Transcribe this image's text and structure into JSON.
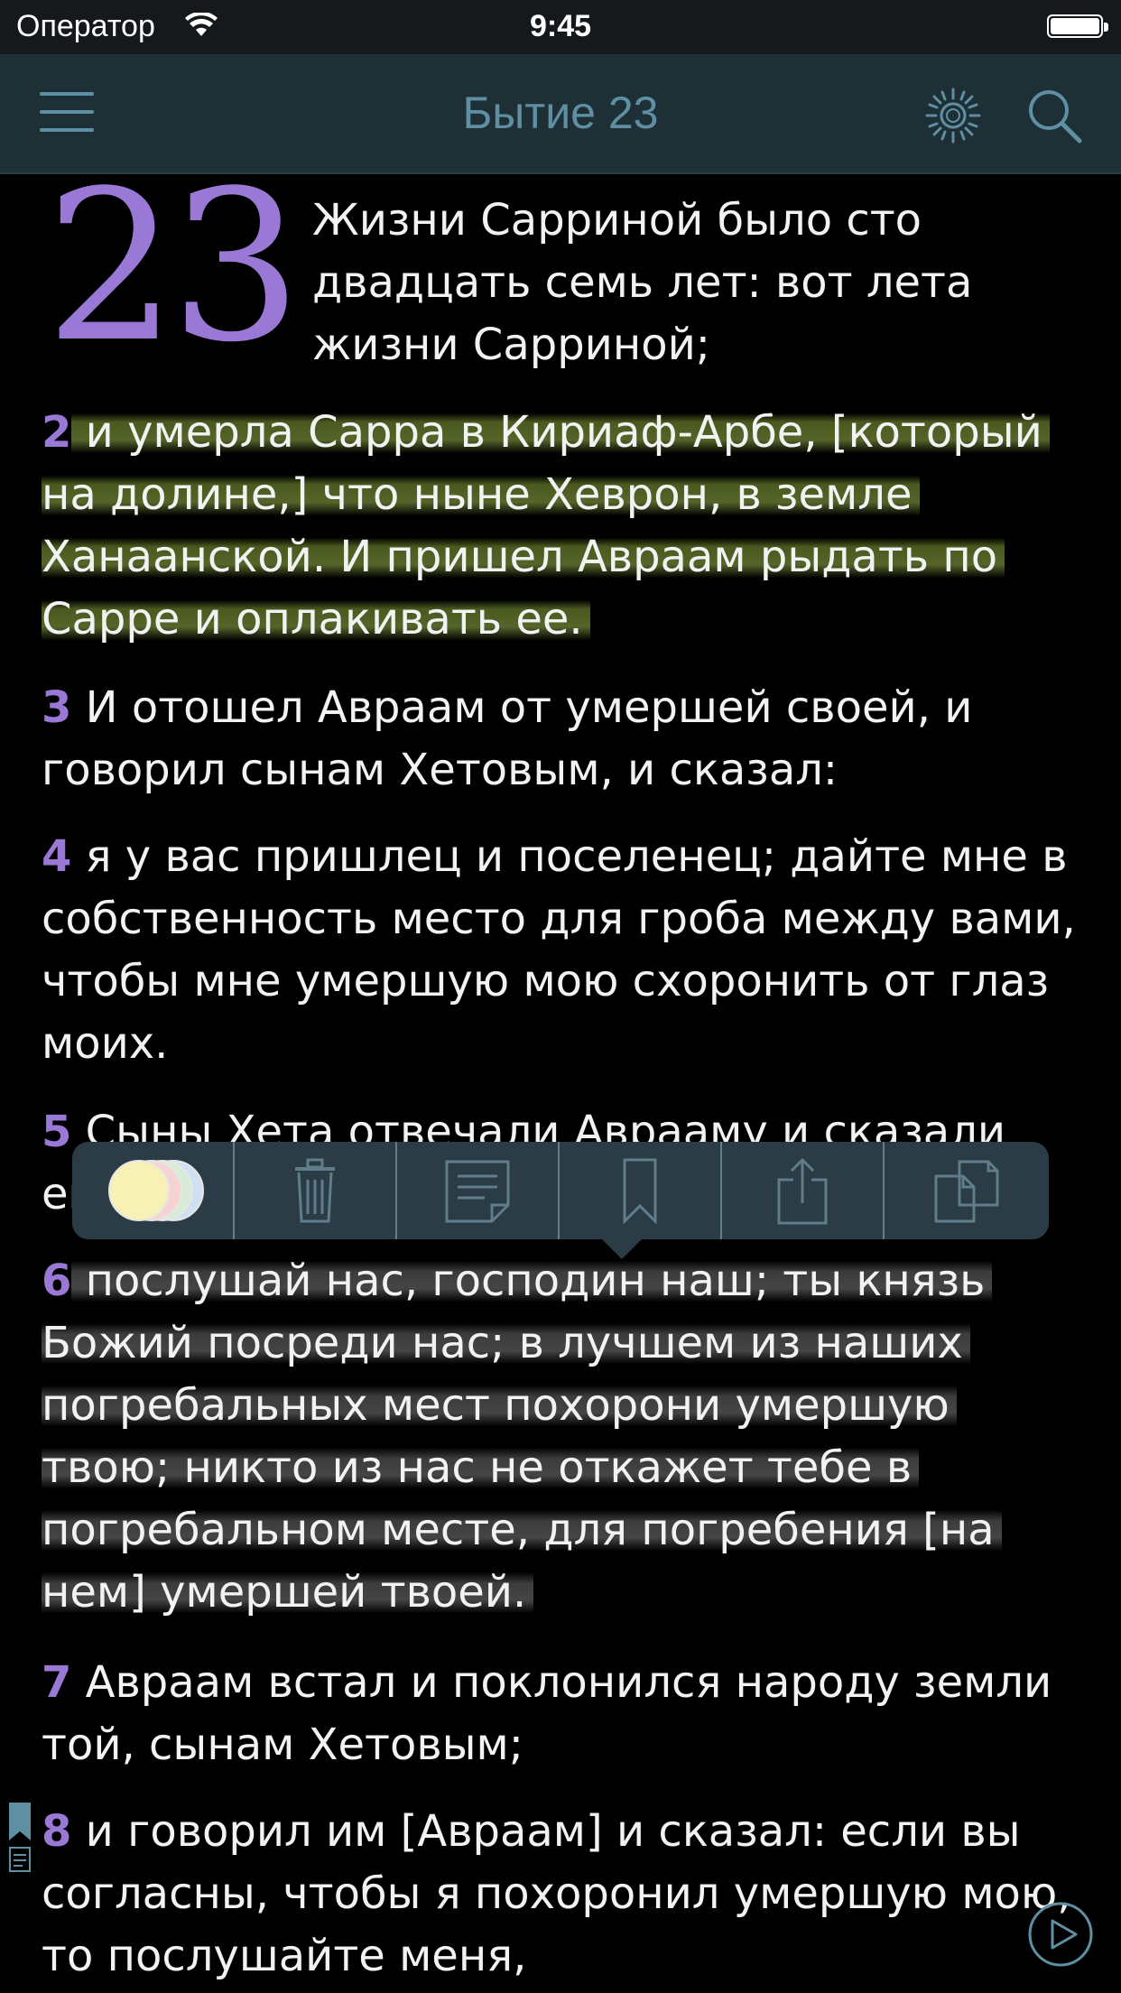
{
  "status_bar": {
    "carrier": "Оператор",
    "time": "9:45"
  },
  "nav": {
    "title": "Бытие 23",
    "menu_icon": "hamburger-menu-icon",
    "theme_icon": "sun-icon",
    "search_icon": "search-icon"
  },
  "chapter": {
    "number": "23",
    "verses": [
      {
        "n": "",
        "text": "Жизни Сарриной было сто двадцать семь лет: вот лета жизни Сарриной;"
      },
      {
        "n": "2",
        "text": " и умерла Сарра в Кириаф-Арбе, [который на долине,] что ныне Хеврон, в земле Ханаанской. И пришел Авраам рыдать по Сарре и оплакивать ее.",
        "highlight": "#55652a"
      },
      {
        "n": "3",
        "text": " И отошел Авраам от умершей своей, и говорил сынам Хетовым, и сказал:"
      },
      {
        "n": "4",
        "text": " я у вас пришлец и поселенец; дайте мне в собственность место для гроба между вами, чтобы мне умершую мою схоронить от глаз моих."
      },
      {
        "n": "5",
        "text": " Сыны Хета отвечали Аврааму и сказали ему:"
      },
      {
        "n": "6",
        "text": " послушай нас, господин наш; ты князь Божий посреди нас; в лучшем из наших погребальных мест похорони умершую твою; никто из нас не откажет тебе в погребальном месте, для погребения [на нем] умершей твоей.",
        "highlight": "#454545"
      },
      {
        "n": "7",
        "text": " Авраам встал и поклонился народу земли той, сынам Хетовым;"
      },
      {
        "n": "8",
        "text": " и говорил им [Авраам] и сказал: если вы согласны, чтобы я похоронил умершую мою, то послушайте меня,"
      }
    ]
  },
  "popover": {
    "items": [
      "color-picker",
      "trash-icon",
      "note-icon",
      "bookmark-icon",
      "share-icon",
      "copy-icon"
    ],
    "colors": [
      "#f7f1b5",
      "#f6d3d3",
      "#d6ecd7",
      "#cfe0f3"
    ]
  },
  "colors": {
    "accent": "#9a79d6",
    "nav_bg": "#1f2f36",
    "nav_text": "#5f8fa3",
    "popover_bg": "#2b3c47"
  }
}
